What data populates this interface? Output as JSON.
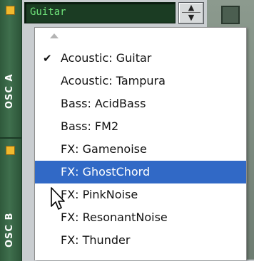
{
  "osc_strips": [
    {
      "label": "OSC A"
    },
    {
      "label": "OSC B"
    }
  ],
  "selector": {
    "value": "Guitar"
  },
  "menu": {
    "items": [
      {
        "label": "Acoustic: Guitar",
        "checked": true
      },
      {
        "label": "Acoustic: Tampura"
      },
      {
        "label": "Bass: AcidBass"
      },
      {
        "label": "Bass: FM2"
      },
      {
        "label": "FX: Gamenoise"
      },
      {
        "label": "FX: GhostChord",
        "highlighted": true
      },
      {
        "label": "FX: PinkNoise"
      },
      {
        "label": "FX: ResonantNoise"
      },
      {
        "label": "FX: Thunder"
      }
    ],
    "check_mark": "✔"
  },
  "colors": {
    "highlight": "#3169c6",
    "display_text": "#6fe27a",
    "led": "#f1b92d"
  }
}
